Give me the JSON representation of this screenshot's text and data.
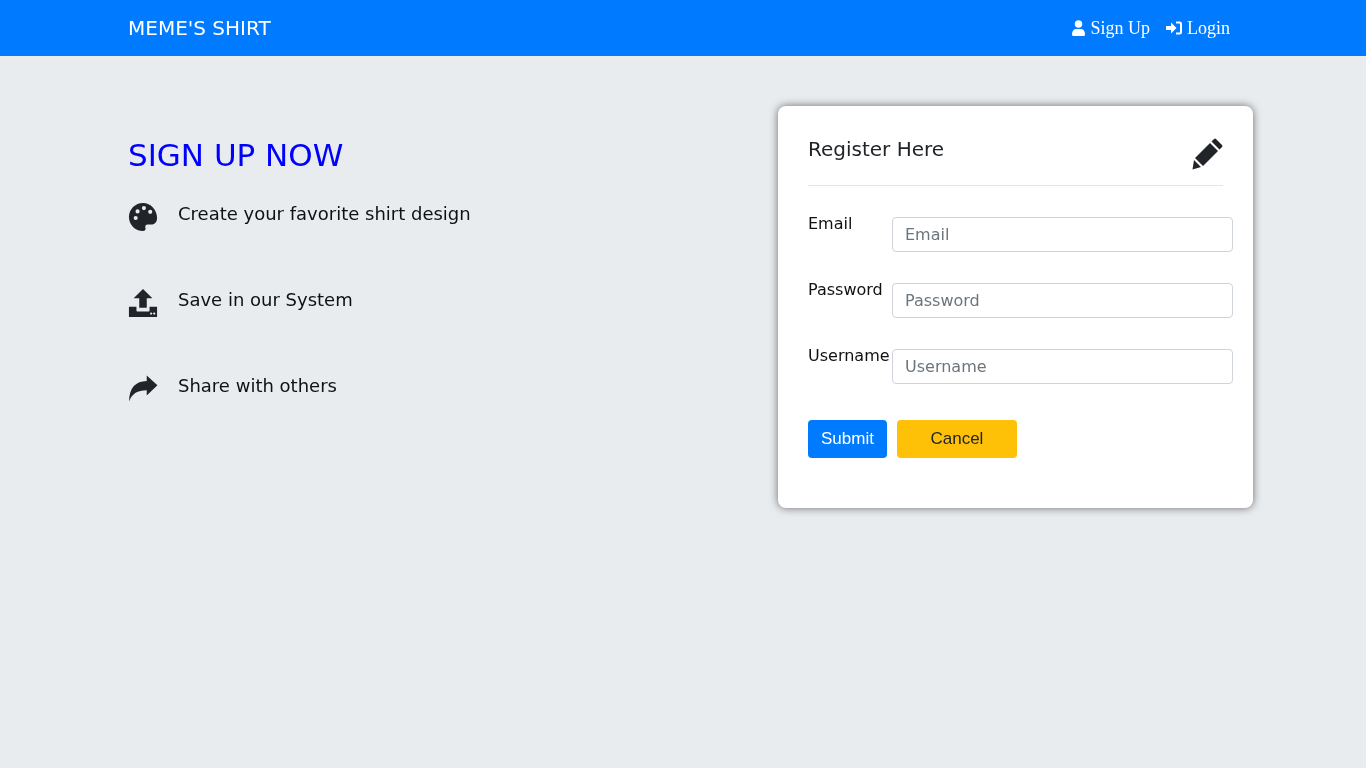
{
  "navbar": {
    "brand": "MEME'S SHIRT",
    "links": [
      {
        "label": "Sign Up"
      },
      {
        "label": "Login"
      }
    ]
  },
  "hero": {
    "title": "SIGN UP NOW",
    "features": [
      {
        "text": "Create your favorite shirt design"
      },
      {
        "text": "Save in our System"
      },
      {
        "text": "Share with others"
      }
    ]
  },
  "register_card": {
    "title": "Register Here",
    "fields": [
      {
        "label": "Email",
        "placeholder": "Email"
      },
      {
        "label": "Password",
        "placeholder": "Password"
      },
      {
        "label": "Username",
        "placeholder": "Username"
      }
    ],
    "buttons": [
      {
        "label": "Submit",
        "kind": "primary"
      },
      {
        "label": "Cancel",
        "kind": "warning"
      }
    ]
  }
}
